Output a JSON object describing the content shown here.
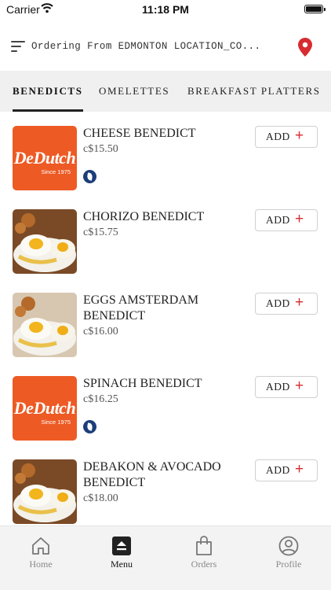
{
  "status_bar": {
    "carrier": "Carrier",
    "time": "11:18 PM"
  },
  "header": {
    "location_text": "Ordering From EDMONTON LOCATION_CO..."
  },
  "tabs": [
    {
      "label": "BENEDICTS",
      "active": true
    },
    {
      "label": "OMELETTES",
      "active": false
    },
    {
      "label": "BREAKFAST PLATTERS",
      "active": false
    }
  ],
  "logo": {
    "brand": "DeDutch",
    "since": "Since 1975"
  },
  "add_button": {
    "label": "ADD",
    "plus": "+"
  },
  "items": [
    {
      "name": "CHEESE BENEDICT",
      "price": "c$15.50",
      "image": "logo",
      "veg_icon": true
    },
    {
      "name": "CHORIZO BENEDICT",
      "price": "c$15.75",
      "image": "photo",
      "veg_icon": false
    },
    {
      "name": "EGGS AMSTERDAM BENEDICT",
      "price": "c$16.00",
      "image": "photo",
      "veg_icon": false
    },
    {
      "name": "SPINACH BENEDICT",
      "price": "c$16.25",
      "image": "logo",
      "veg_icon": true
    },
    {
      "name": "DEBAKON & AVOCADO BENEDICT",
      "price": "c$18.00",
      "image": "photo",
      "veg_icon": false
    }
  ],
  "bottom_nav": [
    {
      "label": "Home",
      "icon": "home-icon",
      "active": false
    },
    {
      "label": "Menu",
      "icon": "menu-icon",
      "active": true
    },
    {
      "label": "Orders",
      "icon": "bag-icon",
      "active": false
    },
    {
      "label": "Profile",
      "icon": "profile-icon",
      "active": false
    }
  ],
  "colors": {
    "accent_red": "#d62b30",
    "brand_orange": "#ed5a24",
    "veg_badge": "#1c3e7a"
  }
}
